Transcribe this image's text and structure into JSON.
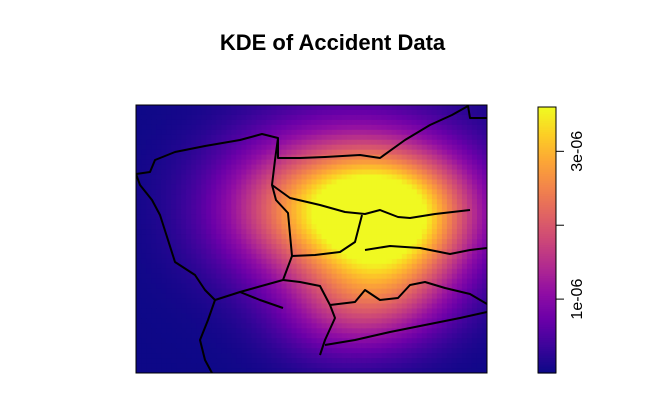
{
  "chart_data": {
    "type": "heatmap",
    "title": "KDE of Accident Data",
    "xlabel": "",
    "ylabel": "",
    "legend": {
      "type": "colorbar",
      "placement": "right",
      "range": [
        0,
        3.6e-06
      ],
      "ticks": [
        {
          "value": 1e-06,
          "label": "1e-06"
        },
        {
          "value": 2e-06,
          "label": ""
        },
        {
          "value": 3e-06,
          "label": "3e-06"
        }
      ],
      "palette": [
        "#0d0887",
        "#3d049b",
        "#6a00a8",
        "#8f0da4",
        "#b12a90",
        "#cc4778",
        "#e16462",
        "#f2844b",
        "#fca636",
        "#fcce25",
        "#f0f921"
      ]
    },
    "grid": false,
    "surface_peaks": [
      {
        "x": 0.73,
        "y": 0.41,
        "height": 1.0,
        "spread": 0.16
      },
      {
        "x": 0.61,
        "y": 0.36,
        "height": 0.55,
        "spread": 0.22
      },
      {
        "x": 0.46,
        "y": 0.4,
        "height": 0.4,
        "spread": 0.17
      },
      {
        "x": 0.71,
        "y": 0.7,
        "height": 0.42,
        "spread": 0.14
      },
      {
        "x": 0.56,
        "y": 0.78,
        "height": 0.22,
        "spread": 0.13
      }
    ],
    "boundary_color": "#000000"
  }
}
